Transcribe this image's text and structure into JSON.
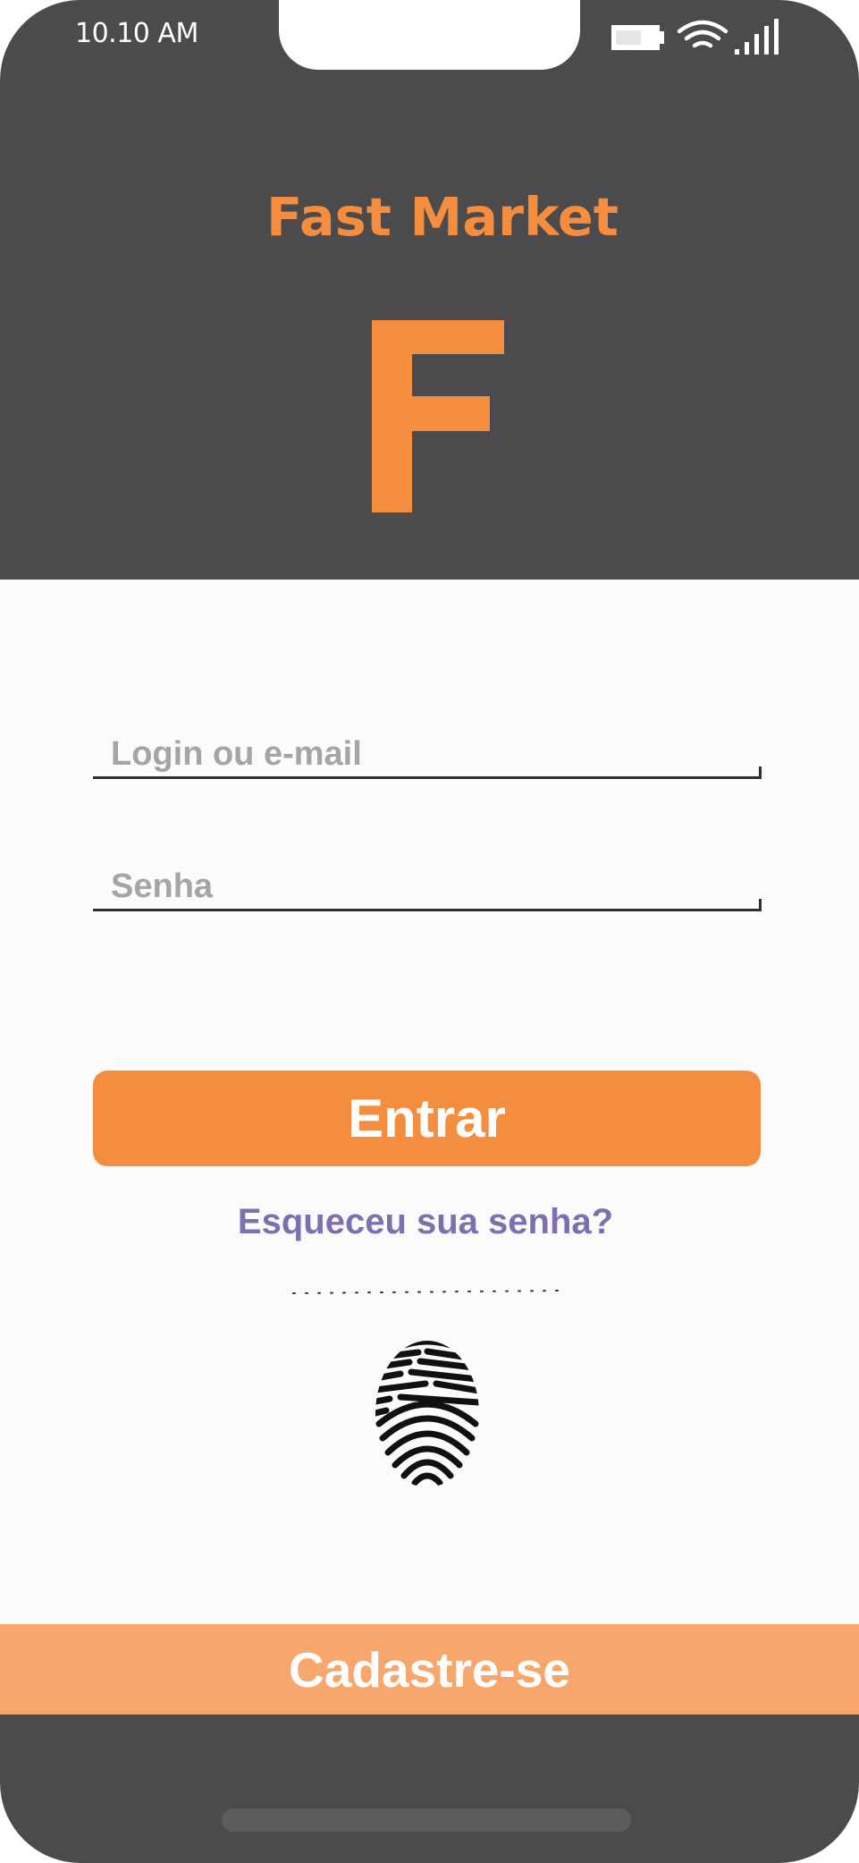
{
  "status_bar": {
    "time": "10.10 AM",
    "icons": [
      "battery-icon",
      "wifi-icon",
      "signal-icon"
    ]
  },
  "brand": {
    "name": "Fast Market",
    "logo_letter": "F"
  },
  "form": {
    "login_placeholder": "Login ou e-mail",
    "password_placeholder": "Senha",
    "submit_label": "Entrar",
    "forgot_label": "Esqueceu sua senha?",
    "biometric_icon": "fingerprint-icon"
  },
  "footer": {
    "signup_label": "Cadastre-se"
  },
  "colors": {
    "accent": "#f58d3f",
    "accent_light": "#f7a76c",
    "dark": "#4b4b4d",
    "link": "#7e70ae",
    "placeholder": "#a5a5a7",
    "background": "#fcfbfb"
  }
}
